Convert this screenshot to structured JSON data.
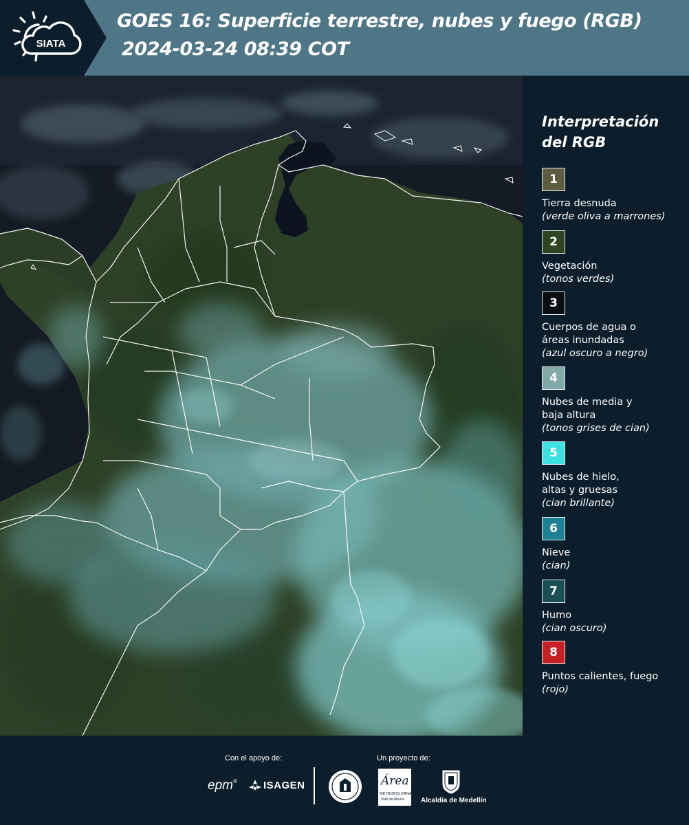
{
  "header": {
    "logo_text": "SIATA",
    "title": "GOES 16: Superficie terrestre, nubes y fuego (RGB)",
    "datetime": "2024-03-24 08:39 COT",
    "band_color": "#4e7687",
    "dark_color": "#0c1e2b"
  },
  "legend": {
    "title_line1": "Interpretación",
    "title_line2": "del RGB",
    "items": [
      {
        "number": "1",
        "label": "Tierra desnuda",
        "note": "(verde oliva a marrones)",
        "color": "#5c5c43"
      },
      {
        "number": "2",
        "label": "Vegetación",
        "note": "(tonos verdes)",
        "color": "#2e4422"
      },
      {
        "number": "3",
        "label": "Cuerpos de agua o\náreas inundadas",
        "note": "(azul oscuro a negro)",
        "color": "#0b0f14"
      },
      {
        "number": "4",
        "label": "Nubes de media y\nbaja altura",
        "note": "(tonos grises de cian)",
        "color": "#81a9a8"
      },
      {
        "number": "5",
        "label": "Nubes de hielo,\naltas y gruesas",
        "note": "(cian brillante)",
        "color": "#3de1e2"
      },
      {
        "number": "6",
        "label": "Nieve",
        "note": "(cian)",
        "color": "#1f8194"
      },
      {
        "number": "7",
        "label": "Humo",
        "note": "(cian oscuro)",
        "color": "#1a5054"
      },
      {
        "number": "8",
        "label": "Puntos calientes, fuego",
        "note": "(rojo)",
        "color": "#c61f24"
      }
    ]
  },
  "footer": {
    "support_caption": "Con el apoyo de:",
    "project_caption": "Un proyecto de:",
    "sponsors": {
      "epm": "epm",
      "isagen": "ISAGEN",
      "area_metro": "Área",
      "area_metro_sub1": "METROPOLITANA",
      "area_metro_sub2": "Valle de Aburrá",
      "alcaldia": "Alcaldía de Medellín"
    }
  },
  "map": {
    "description_colors": {
      "ocean": "#151c26",
      "land_green": "#2f4a2c",
      "cloud_cyan": "#5fb3b2",
      "border": "#ffffff"
    }
  }
}
